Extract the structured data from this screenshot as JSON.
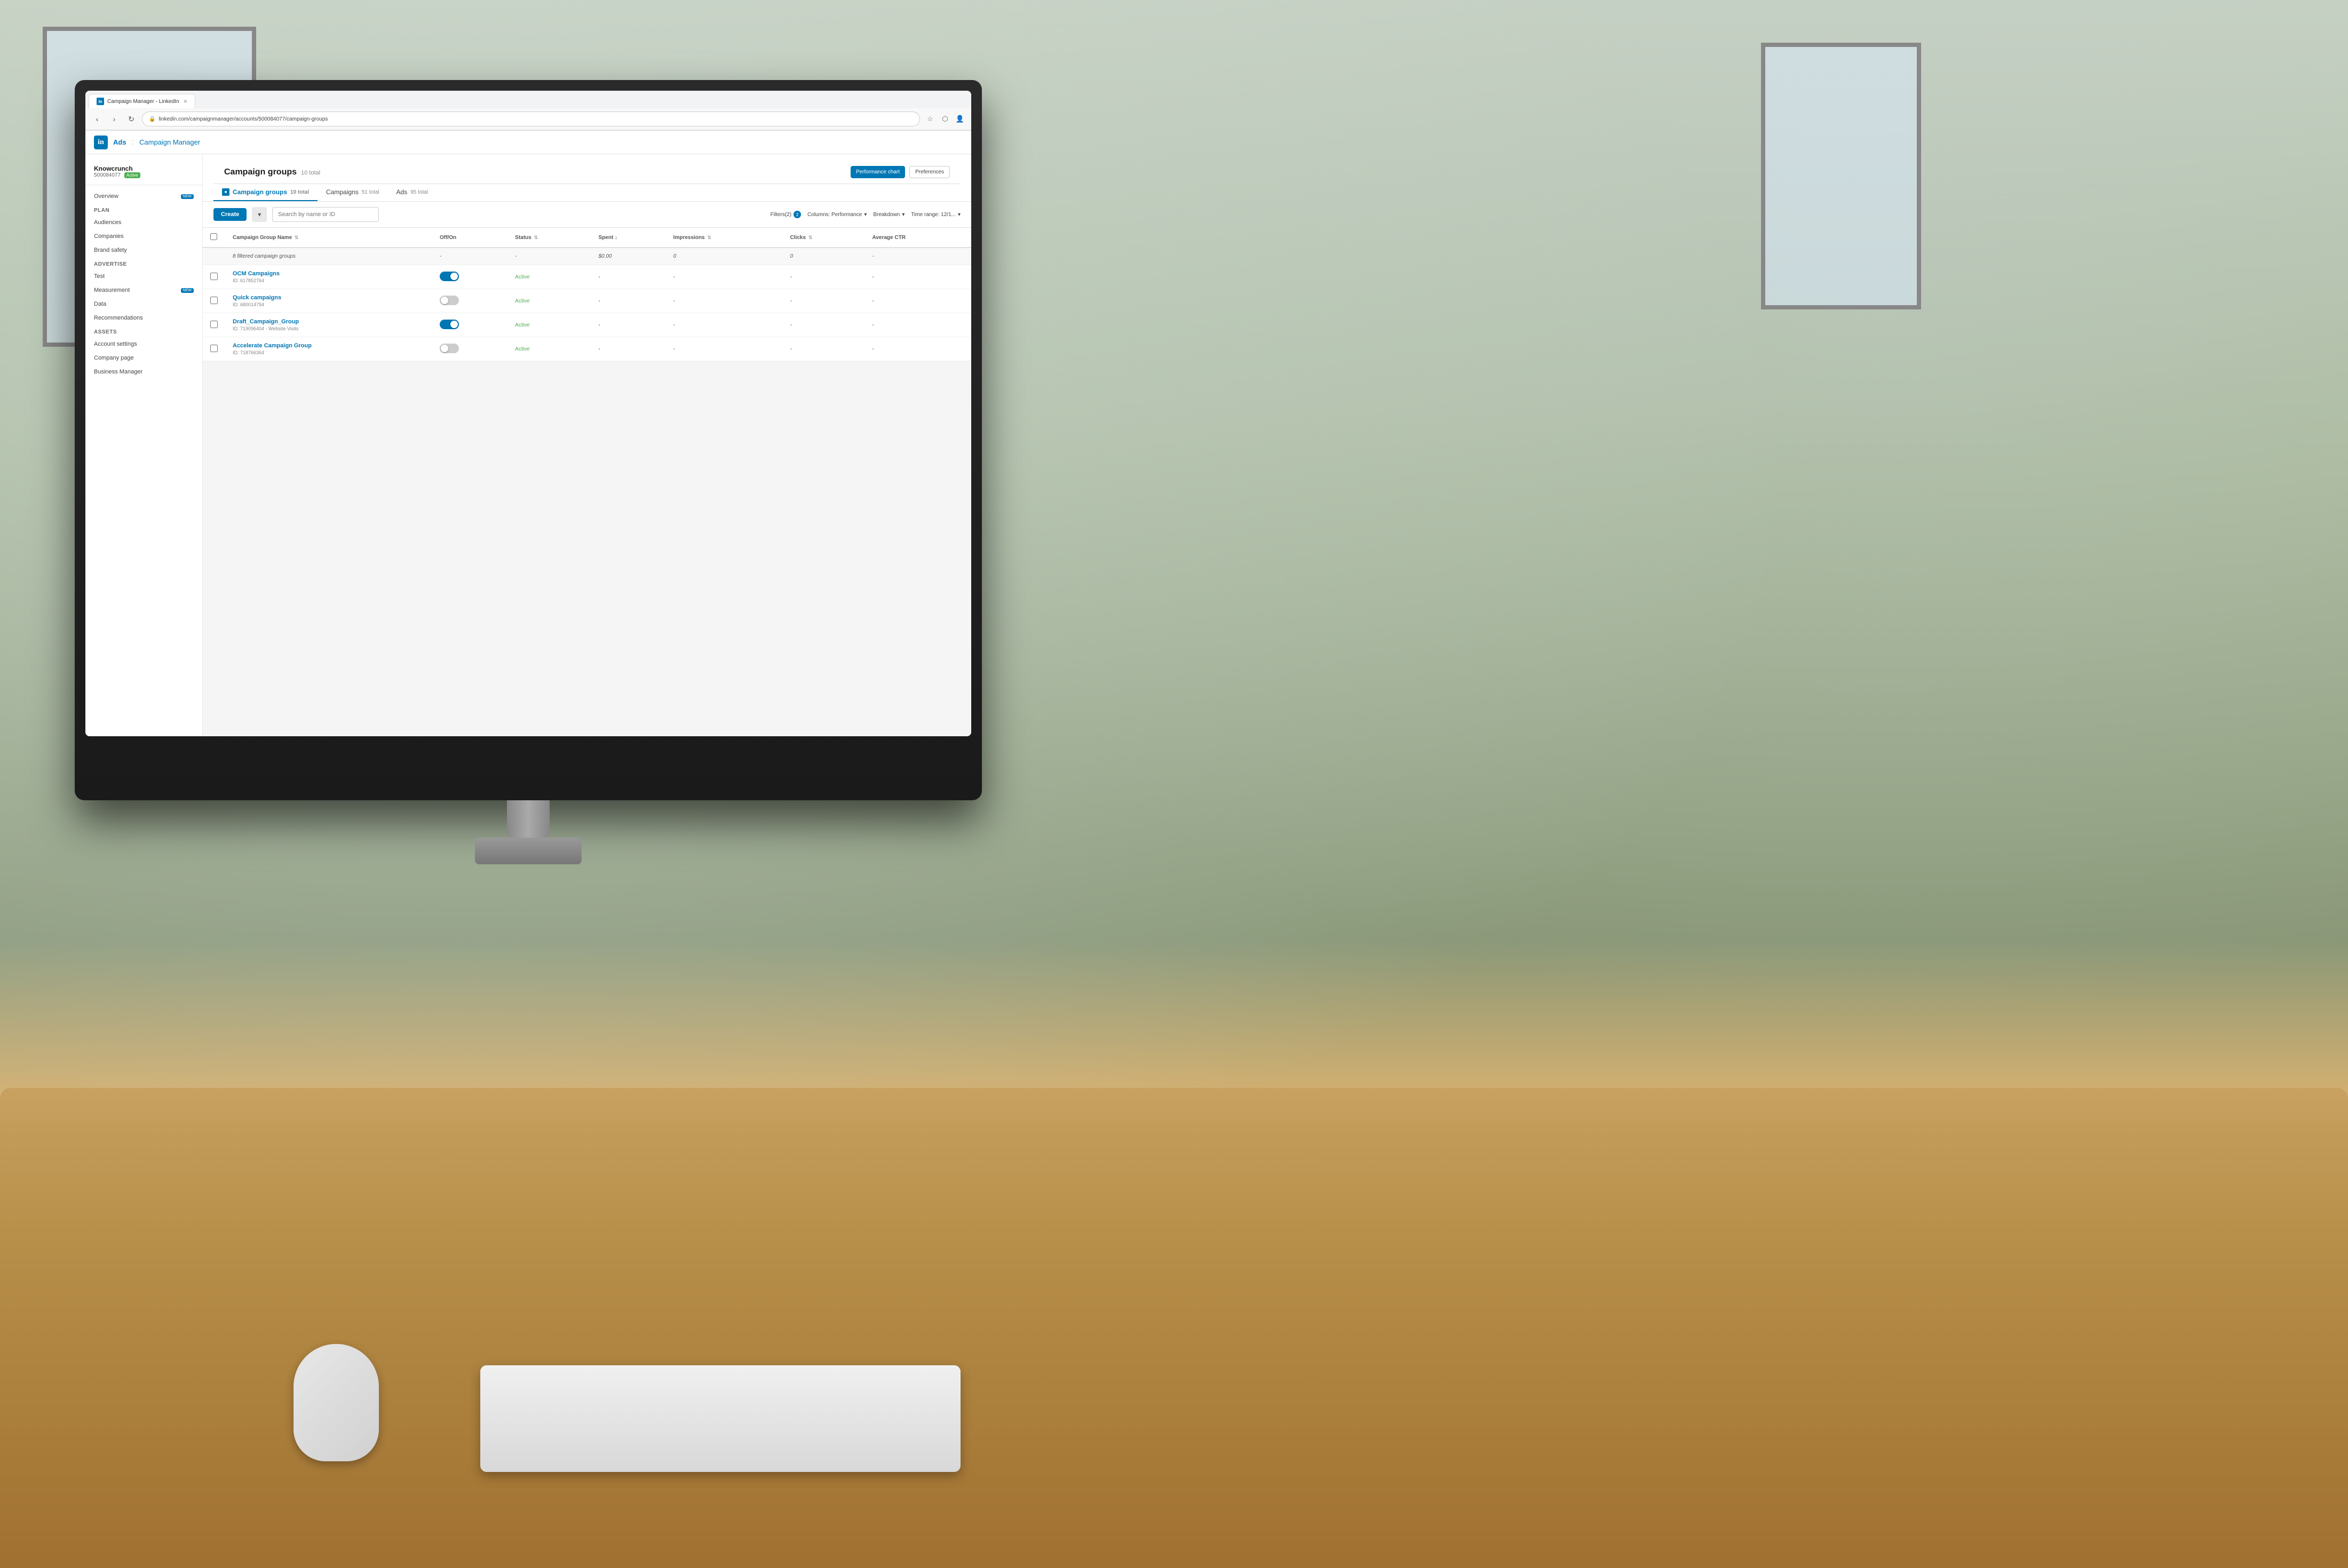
{
  "browser": {
    "tab_title": "Campaign Manager - LinkedIn",
    "tab_favicon": "in",
    "url": "linkedin.com/campaignmanager/accounts/500084077/campaign-groups",
    "lock_icon": "🔒"
  },
  "app": {
    "logo_text": "in",
    "breadcrumb": "Ads : Campaign Manager",
    "header_title": "Ads",
    "header_sep": ":",
    "header_subtitle": "Campaign Manager"
  },
  "sidebar": {
    "account_name": "Knowcrunch",
    "account_id": "500084077",
    "account_status": "Active",
    "overview_label": "Overview",
    "overview_badge": "NEW",
    "plan_label": "Plan",
    "audiences_label": "Audiences",
    "companies_label": "Companies",
    "brand_safety_label": "Brand safety",
    "advertise_label": "Advertise",
    "test_label": "Test",
    "measurement_label": "Measurement",
    "measurement_badge": "NEW",
    "data_label": "Data",
    "recommendations_label": "Recommendations",
    "assets_label": "Assets",
    "account_settings_label": "Account settings",
    "company_page_label": "Company page",
    "business_manager_label": "Business Manager"
  },
  "content": {
    "page_title": "Campaign groups",
    "total_count": "10 total",
    "tabs": [
      {
        "label": "Campaign groups",
        "count": "10 total",
        "icon": "cg",
        "active": true
      },
      {
        "label": "Campaigns",
        "count": "51 total",
        "icon": "c",
        "active": false
      },
      {
        "label": "Ads",
        "count": "95 total",
        "icon": "a",
        "active": false
      }
    ],
    "create_btn": "Create",
    "search_placeholder": "Search by name or ID",
    "filters_label": "Filters(2)",
    "columns_label": "Columns: Performance",
    "breakdown_label": "Breakdown",
    "time_range_label": "Time range: 12/1...",
    "performance_chart_btn": "Performance chart",
    "preferences_btn": "Preferences",
    "table": {
      "headers": [
        {
          "label": "Campaign Group Name",
          "sortable": true
        },
        {
          "label": "Off/On",
          "sortable": false
        },
        {
          "label": "Status",
          "sortable": true
        },
        {
          "label": "Spent ↓",
          "sortable": true
        },
        {
          "label": "Impressions",
          "sortable": true
        },
        {
          "label": "Clicks",
          "sortable": true
        },
        {
          "label": "Average CTR",
          "sortable": true
        }
      ],
      "filtered_row": {
        "label": "8 filtered campaign groups",
        "spent": "$0.00",
        "impressions": "0",
        "clicks": "0",
        "ctr": "-"
      },
      "rows": [
        {
          "name": "OCM Campaigns",
          "id": "617852764",
          "toggle": "on",
          "status": "Active",
          "spent": "-",
          "impressions": "-",
          "clicks": "-",
          "ctr": "-"
        },
        {
          "name": "Quick campaigns",
          "id": "680014794",
          "toggle": "off",
          "status": "Active",
          "spent": "-",
          "impressions": "-",
          "clicks": "-",
          "ctr": "-"
        },
        {
          "name": "Draft_Campaign_Group",
          "id": "719096404 - Website Visits",
          "toggle": "on",
          "status": "Active",
          "spent": "-",
          "impressions": "-",
          "clicks": "-",
          "ctr": "-"
        },
        {
          "name": "Accelerate Campaign Group",
          "id": "718766364",
          "toggle": "off",
          "status": "Active",
          "spent": "-",
          "impressions": "-",
          "clicks": "-",
          "ctr": "-"
        }
      ]
    }
  }
}
